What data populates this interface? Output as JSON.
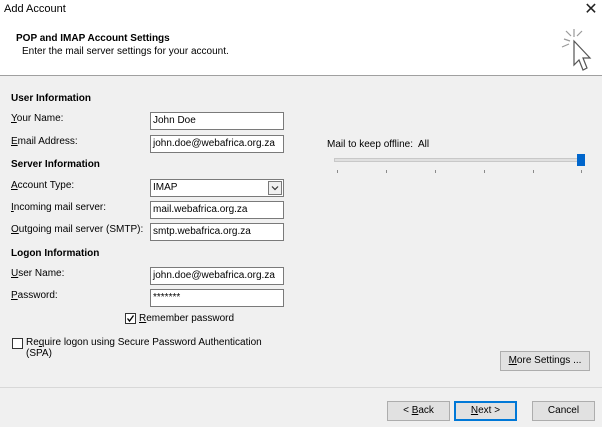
{
  "window": {
    "title": "Add Account"
  },
  "header": {
    "title": "POP and IMAP Account Settings",
    "subtitle": "Enter the mail server settings for your account."
  },
  "sections": {
    "user_info": "User Information",
    "server_info": "Server Information",
    "logon_info": "Logon Information"
  },
  "fields": {
    "your_name": {
      "label_accel": "Y",
      "label_rest": "our Name:",
      "value": "John Doe"
    },
    "email": {
      "label_accel": "E",
      "label_rest": "mail Address:",
      "value": "john.doe@webafrica.org.za"
    },
    "account_type": {
      "label_accel": "A",
      "label_rest": "ccount Type:",
      "value": "IMAP"
    },
    "incoming": {
      "label_accel": "I",
      "label_rest": "ncoming mail server:",
      "value": "mail.webafrica.org.za"
    },
    "outgoing": {
      "label_accel": "O",
      "label_rest": "utgoing mail server (SMTP):",
      "value": "smtp.webafrica.org.za"
    },
    "user_name": {
      "label_accel": "U",
      "label_rest": "ser Name:",
      "value": "john.doe@webafrica.org.za"
    },
    "password": {
      "label_accel": "P",
      "label_rest": "assword:",
      "value": "*******"
    }
  },
  "remember": {
    "accel": "R",
    "rest": "emember password",
    "checked": true
  },
  "spa": {
    "accel": "q",
    "pre": "Re",
    "rest": "uire logon using Secure Password Authentication",
    "line2": "(SPA)",
    "checked": false
  },
  "offline": {
    "label": "Mail to keep offline:",
    "value": "All",
    "level_percent": 100
  },
  "buttons": {
    "more_settings_accel": "M",
    "more_settings_rest": "ore Settings ...",
    "back_pre": "< ",
    "back_accel": "B",
    "back_rest": "ack",
    "next_accel": "N",
    "next_rest": "ext >",
    "cancel": "Cancel"
  },
  "icons": {
    "close": "close-icon",
    "cursor_art": "cursor-sparkle-icon",
    "checkmark": "checkmark-icon",
    "dropdown": "chevron-down-icon"
  }
}
